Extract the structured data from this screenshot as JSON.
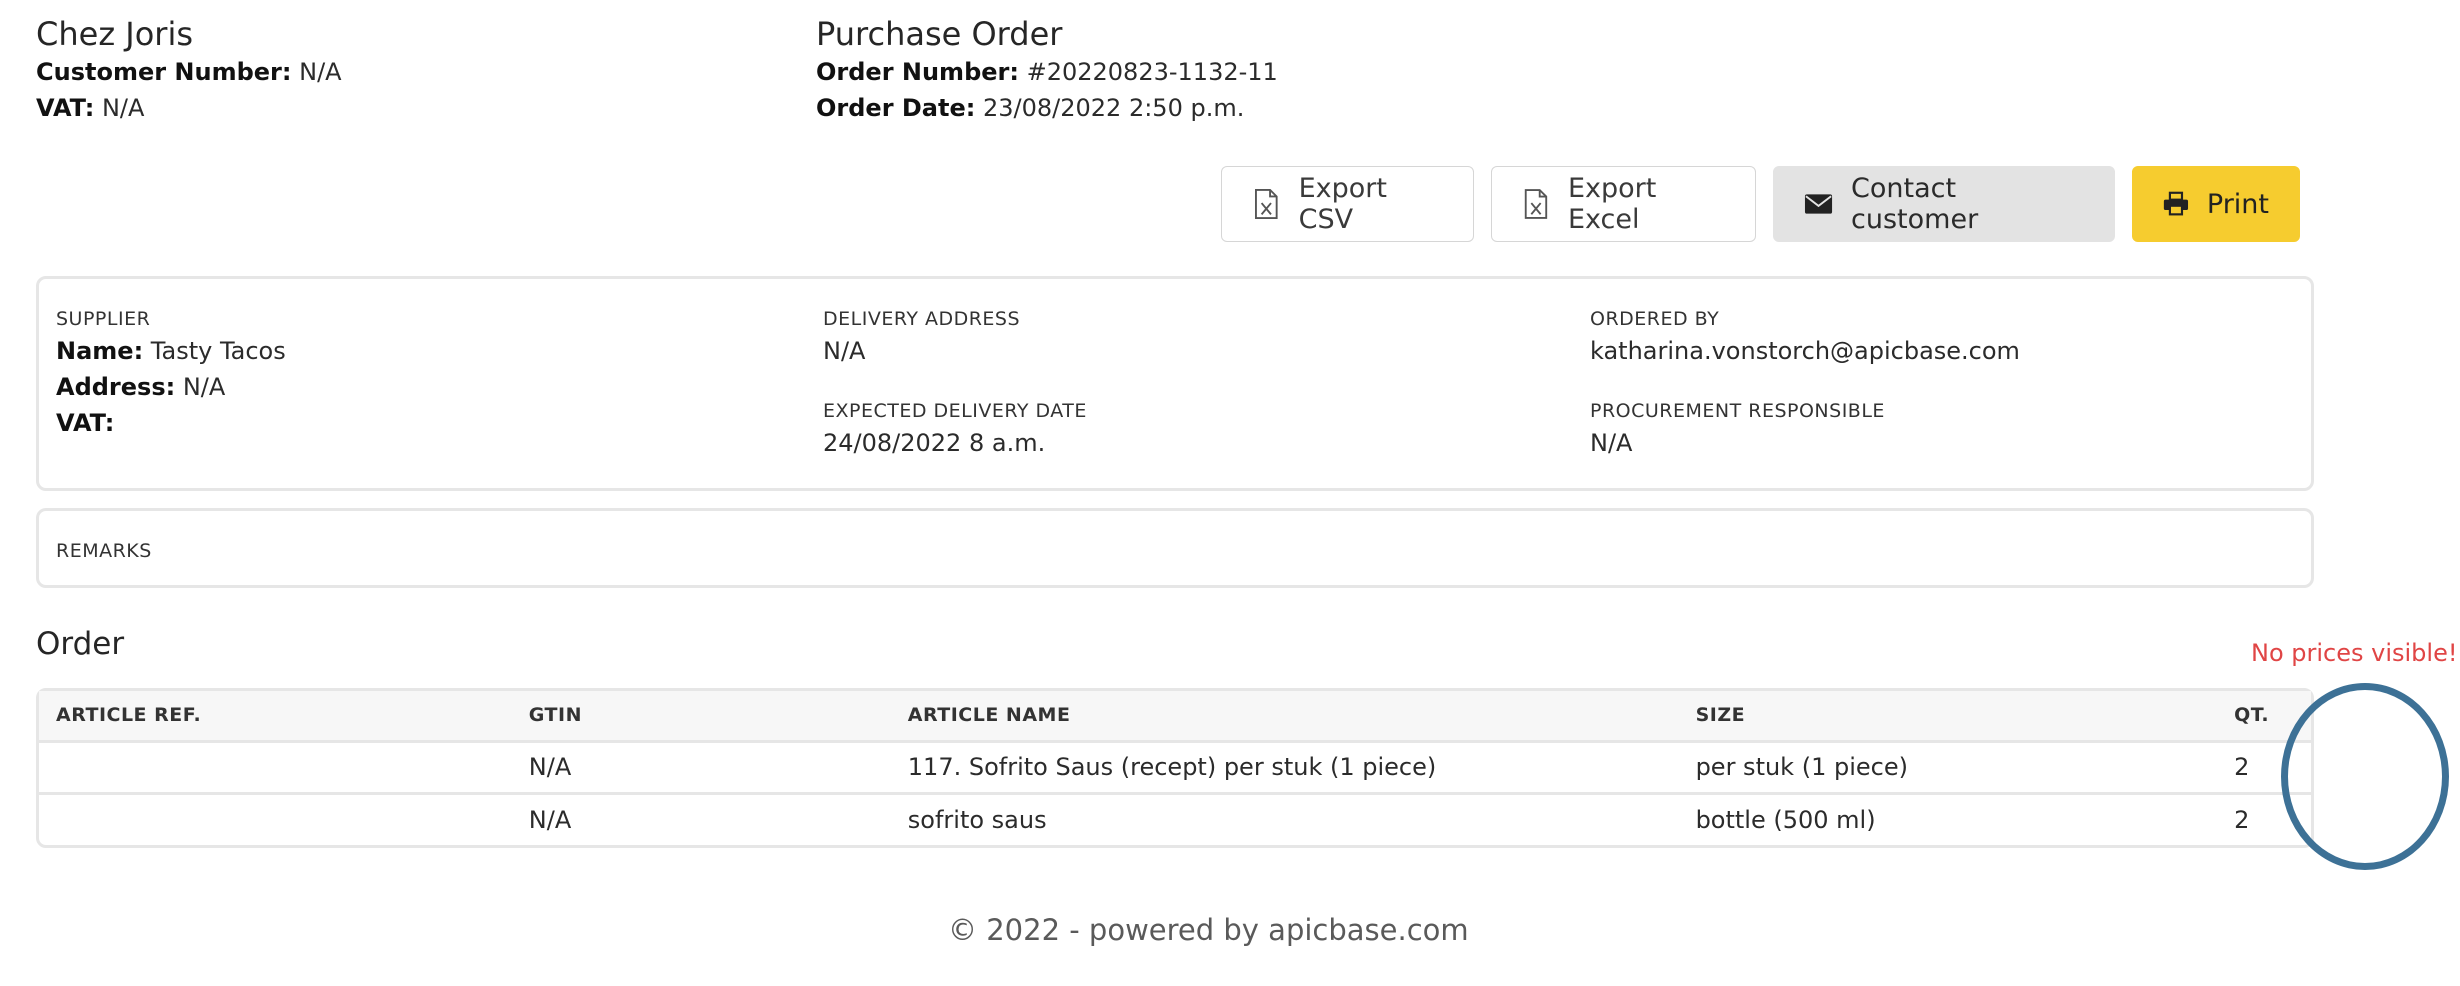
{
  "header": {
    "company_name": "Chez Joris",
    "customer_number_label": "Customer Number:",
    "customer_number": " N/A",
    "vat_label": "VAT:",
    "vat": " N/A",
    "document_title": "Purchase Order",
    "order_number_label": "Order Number:",
    "order_number": " #20220823-1132-11",
    "order_date_label": "Order Date:",
    "order_date": " 23/08/2022 2:50 p.m."
  },
  "toolbar": {
    "export_csv": "Export CSV",
    "export_excel": "Export Excel",
    "contact_customer": "Contact customer",
    "print": "Print"
  },
  "info": {
    "supplier_label": "SUPPLIER",
    "name_label": "Name:",
    "name": " Tasty Tacos",
    "address_label": "Address:",
    "address": " N/A",
    "vat_label": "VAT:",
    "delivery_address_label": "DELIVERY ADDRESS",
    "delivery_address": "N/A",
    "expected_delivery_label": "EXPECTED DELIVERY DATE",
    "expected_delivery": "24/08/2022 8 a.m.",
    "ordered_by_label": "ORDERED BY",
    "ordered_by": "katharina.vonstorch@apicbase.com",
    "procurement_label": "PROCUREMENT RESPONSIBLE",
    "procurement": "N/A"
  },
  "remarks": {
    "label": "REMARKS"
  },
  "order": {
    "title": "Order",
    "annotation": "No prices visible!",
    "columns": [
      "ARTICLE REF.",
      "GTIN",
      "ARTICLE NAME",
      "SIZE",
      "QT."
    ],
    "rows": [
      [
        "",
        "N/A",
        "117. Sofrito Saus (recept) per stuk (1 piece)",
        "per stuk (1 piece)",
        "2"
      ],
      [
        "",
        "N/A",
        "sofrito saus",
        "bottle (500 ml)",
        "2"
      ]
    ]
  },
  "footer": {
    "text": "© 2022 - powered by apicbase.com"
  },
  "colors": {
    "print_button": "#f6cc2f",
    "contact_button": "#e3e3e3",
    "annotation_text": "#e04545",
    "annotation_ring": "#3d7196"
  },
  "icons": {
    "export_csv": "file-excel-icon",
    "export_excel": "file-excel-icon",
    "contact_customer": "envelope-icon",
    "print": "printer-icon"
  }
}
